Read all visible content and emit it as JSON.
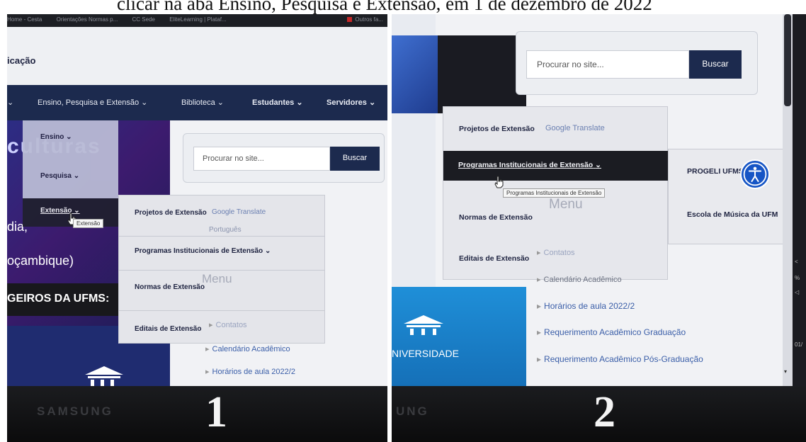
{
  "caption": "clicar na aba Ensino, Pesquisa e Extensão, em 1 de dezembro de 2022",
  "colors": {
    "navbar": "#1c2a4e",
    "dropdown_active": "#1b1c22",
    "link_blue": "#3a5ea8",
    "accessibility_blue": "#1655c5"
  },
  "photo1": {
    "number": "1",
    "brand": "SAMSUNG",
    "browser_tabs": [
      "Home - Cesta",
      "Orientações Normas p...",
      "CC Sede",
      "EliteLearning | Plataf..."
    ],
    "browser_tab_right": "Outros fa...",
    "site_title": "icação",
    "nav": {
      "ensino_pesquisa_extensao": "Ensino, Pesquisa e Extensão",
      "biblioteca": "Biblioteca",
      "estudantes": "Estudantes",
      "servidores": "Servidores"
    },
    "hero": {
      "big": "culturas",
      "line1": "dia,",
      "line2": "oçambique)",
      "strip": "GEIROS DA UFMS:"
    },
    "dropdown": {
      "ensino": "Ensino",
      "pesquisa": "Pesquisa",
      "extensao": "Extensão",
      "tooltip": "Extensão"
    },
    "submenu": {
      "projetos": "Projetos de Extensão",
      "programas": "Programas Institucionais de Extensão",
      "normas": "Normas de Extensão",
      "editais": "Editais de Extensão"
    },
    "search": {
      "placeholder": "Procurar no site...",
      "button": "Buscar"
    },
    "google_translate": "Google Translate",
    "portugues": "Português",
    "menu_title": "Menu",
    "links": {
      "contatos": "Contatos",
      "calendario": "Calendário Acadêmico",
      "horarios": "Horários de aula 2022/2"
    }
  },
  "photo2": {
    "number": "2",
    "brand": "UNG",
    "search": {
      "placeholder": "Procurar no site...",
      "button": "Buscar"
    },
    "dropdown": {
      "projetos": "Projetos de Extensão",
      "programas": "Programas Institucionais de Extensão",
      "normas": "Normas de Extensão",
      "editais": "Editais de Extensão",
      "tooltip": "Programas Institucionais de Extensão"
    },
    "google_translate": "Google Translate",
    "submenu": {
      "progeli": "PROGELI UFMS",
      "escola": "Escola de Música da UFM"
    },
    "menu_title": "Menu",
    "universidade": "NIVERSIDADE",
    "links": {
      "contatos": "Contatos",
      "calendario": "Calendário Acadêmico",
      "horarios": "Horários de aula 2022/2",
      "req_grad": "Requerimento Acadêmico Graduação",
      "req_pos": "Requerimento Acadêmico Pós-Graduação"
    },
    "side_icons": {
      "a": "<",
      "b": "%",
      "c": "◁",
      "d": "01/"
    }
  }
}
